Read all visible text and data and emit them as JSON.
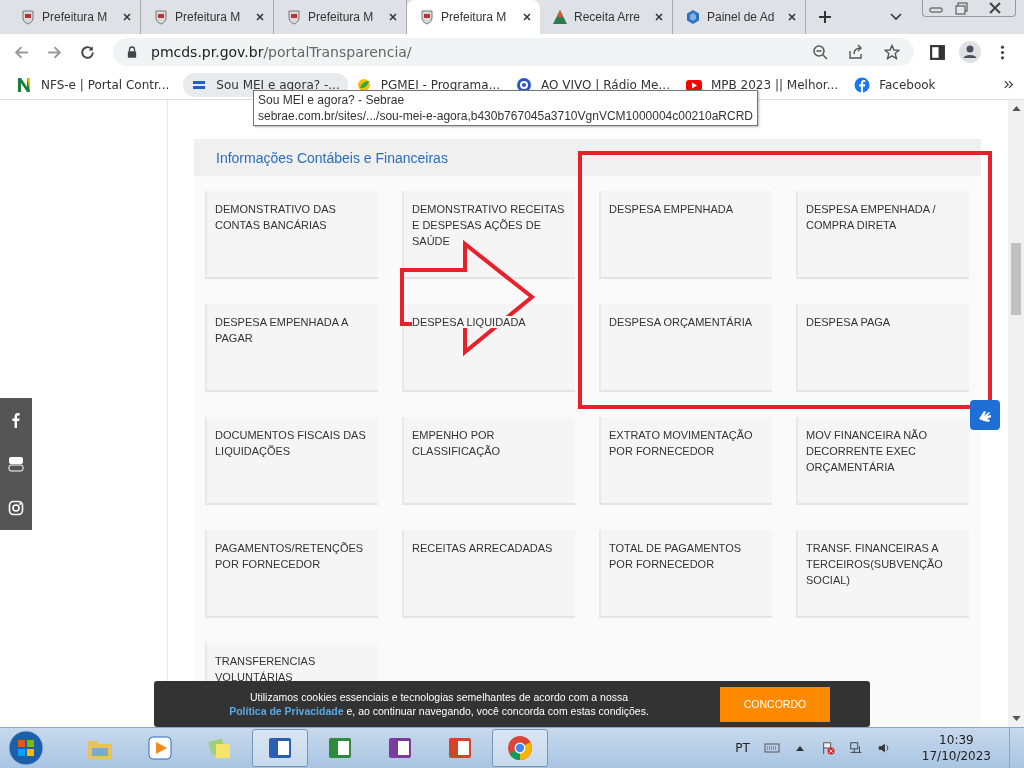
{
  "tabs": [
    {
      "title": "Prefeitura M",
      "selected": false
    },
    {
      "title": "Prefeitura M",
      "selected": false
    },
    {
      "title": "Prefeitura M",
      "selected": false
    },
    {
      "title": "Prefeitura M",
      "selected": true
    },
    {
      "title": "Receita Arre",
      "selected": false
    },
    {
      "title": "Painel de Ad",
      "selected": false
    }
  ],
  "address": {
    "host": "pmcds.pr.gov.br",
    "path": "/portalTransparencia/"
  },
  "bookmarks": [
    {
      "label": "NFS-e | Portal Contr...",
      "hovered": false
    },
    {
      "label": "Sou MEI e agora? -...",
      "hovered": true
    },
    {
      "label": "PGMEI - Programa...",
      "hovered": false
    },
    {
      "label": "AO VIVO | Rádio Me...",
      "hovered": false
    },
    {
      "label": "MPB 2023 || Melhor...",
      "hovered": false
    },
    {
      "label": "Facebook",
      "hovered": false
    }
  ],
  "tooltip": {
    "title": "Sou MEI e agora? - Sebrae",
    "url": "sebrae.com.br/sites/.../sou-mei-e-agora,b430b767045a3710VgnVCM1000004c00210aRCRD"
  },
  "section": {
    "title": "Informações Contábeis e Financeiras",
    "cards": [
      "DEMONSTRATIVO DAS CONTAS BANCÁRIAS",
      "DEMONSTRATIVO RECEITAS E DESPESAS AÇÕES DE SAÚDE",
      "DESPESA EMPENHADA",
      "DESPESA EMPENHADA / COMPRA DIRETA",
      "DESPESA EMPENHADA A PAGAR",
      "DESPESA LIQUIDADA",
      "DESPESA ORÇAMENTÁRIA",
      "DESPESA PAGA",
      "DOCUMENTOS FISCAIS DAS LIQUIDAÇÕES",
      "EMPENHO POR CLASSIFICAÇÃO",
      "EXTRATO MOVIMENTAÇÃO POR FORNECEDOR",
      "MOV FINANCEIRA NÃO DECORRENTE EXEC ORÇAMENTÁRIA",
      "PAGAMENTOS/RETENÇÕES POR FORNECEDOR",
      "RECEITAS ARRECADADAS",
      "TOTAL DE PAGAMENTOS POR FORNECEDOR",
      "TRANSF. FINANCEIRAS A TERCEIROS(SUBVENÇÃO SOCIAL)",
      "TRANSFERENCIAS VOLUNTÁRIAS"
    ]
  },
  "cookie": {
    "text_before": "Utilizamos cookies essenciais e tecnologias semelhantes de acordo com a nossa",
    "link": "Política de Privacidade",
    "text_after": "e, ao continuar navegando, você concorda com estas condições.",
    "button": "CONCORDO"
  },
  "taskbar": {
    "apps": [
      {
        "active": false
      },
      {
        "active": false
      },
      {
        "active": false
      },
      {
        "active": true
      },
      {
        "active": false
      },
      {
        "active": false
      },
      {
        "active": false
      },
      {
        "active": true
      }
    ],
    "language": "PT",
    "time": "10:39",
    "date": "17/10/2023"
  }
}
